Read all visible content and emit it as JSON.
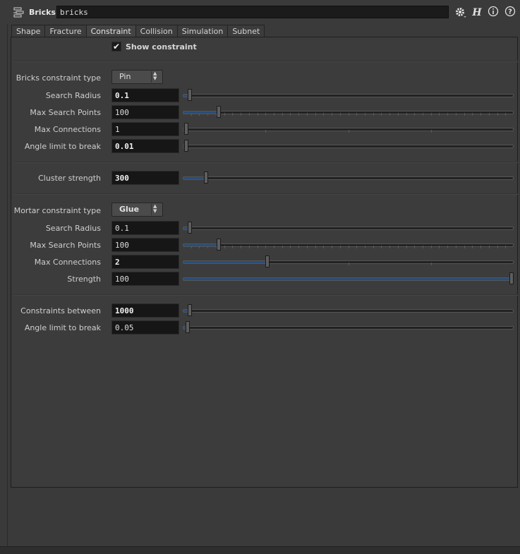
{
  "header": {
    "node_type": "Bricks",
    "node_name": "bricks",
    "icons": [
      "node-type-icon",
      "gear-icon",
      "houdini-help-icon",
      "info-icon",
      "help-icon"
    ]
  },
  "tabs": [
    {
      "label": "Shape",
      "active": false
    },
    {
      "label": "Fracture",
      "active": false
    },
    {
      "label": "Constraint",
      "active": true
    },
    {
      "label": "Collision",
      "active": false
    },
    {
      "label": "Simulation",
      "active": false
    },
    {
      "label": "Subnet",
      "active": false
    }
  ],
  "show_constraint": {
    "label": "Show constraint",
    "checked": true
  },
  "bricks": {
    "constraint_type": {
      "label": "Bricks constraint type",
      "value": "Pin"
    },
    "search_radius": {
      "label": "Search Radius",
      "value": "0.1",
      "level": 0.01
    },
    "max_search_points": {
      "label": "Max Search Points",
      "value": "100",
      "level": 0.1
    },
    "max_connections": {
      "label": "Max Connections",
      "value": "1",
      "level": 0.0
    },
    "angle_limit": {
      "label": "Angle limit to break",
      "value": "0.01",
      "level": 0.0
    }
  },
  "cluster": {
    "label": "Cluster strength",
    "value": "300",
    "level": 0.06
  },
  "mortar": {
    "constraint_type": {
      "label": "Mortar constraint type",
      "value": "Glue"
    },
    "search_radius": {
      "label": "Search Radius",
      "value": "0.1",
      "level": 0.01
    },
    "max_search_points": {
      "label": "Max Search Points",
      "value": "100",
      "level": 0.1
    },
    "max_connections": {
      "label": "Max Connections",
      "value": "2",
      "level": 0.25
    },
    "strength": {
      "label": "Strength",
      "value": "100",
      "level": 1.0
    }
  },
  "constraints_between": {
    "label": "Constraints between",
    "value": "1000",
    "level": 0.01
  },
  "angle_limit_2": {
    "label": "Angle limit to break",
    "value": "0.05",
    "level": 0.005
  },
  "colors": {
    "accent_fill": "#2a4d78",
    "background": "#3a3a3a",
    "field": "#161616"
  }
}
